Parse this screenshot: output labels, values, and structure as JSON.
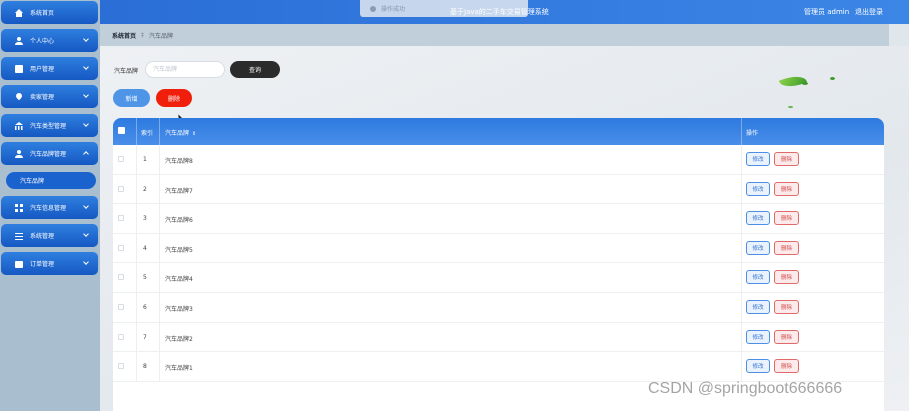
{
  "sidebar": {
    "items": [
      {
        "label": "系统首页",
        "icon": "home-icon",
        "chevron": false
      },
      {
        "label": "个人中心",
        "icon": "user-icon",
        "chevron": true
      },
      {
        "label": "用户管理",
        "icon": "document-icon",
        "chevron": true
      },
      {
        "label": "卖家管理",
        "icon": "location-pin-icon",
        "chevron": true
      },
      {
        "label": "汽车类型管理",
        "icon": "bank-icon",
        "chevron": true
      },
      {
        "label": "汽车品牌管理",
        "icon": "user-icon",
        "chevron": true,
        "expanded": true
      },
      {
        "label": "汽车信息管理",
        "icon": "grid-icon",
        "chevron": true
      },
      {
        "label": "系统管理",
        "icon": "menu-icon",
        "chevron": true
      },
      {
        "label": "订单管理",
        "icon": "bag-icon",
        "chevron": true
      }
    ],
    "sub_item": "汽车品牌"
  },
  "header": {
    "toast": "操作成功",
    "title": "基于Java的二手车交易管理系统",
    "admin": "管理员 admin",
    "logout": "退出登录"
  },
  "breadcrumb": {
    "home": "系统首页",
    "separator": "‡",
    "current": "汽车品牌"
  },
  "search": {
    "label": "汽车品牌",
    "placeholder": "汽车品牌",
    "value": "",
    "button": "查询"
  },
  "actions": {
    "add": "新增",
    "delete": "删除"
  },
  "table": {
    "headers": {
      "index": "索引",
      "brand": "汽车品牌",
      "sort_icon": "⇕",
      "ops": "操作"
    },
    "edit_label": "修改",
    "delete_label": "删除",
    "rows": [
      {
        "index": "1",
        "brand": "汽车品牌8"
      },
      {
        "index": "2",
        "brand": "汽车品牌7"
      },
      {
        "index": "3",
        "brand": "汽车品牌6"
      },
      {
        "index": "4",
        "brand": "汽车品牌5"
      },
      {
        "index": "5",
        "brand": "汽车品牌4"
      },
      {
        "index": "6",
        "brand": "汽车品牌3"
      },
      {
        "index": "7",
        "brand": "汽车品牌2"
      },
      {
        "index": "8",
        "brand": "汽车品牌1"
      }
    ]
  },
  "watermark": "CSDN @springboot666666",
  "colors": {
    "primary": "#2a6ed6",
    "danger": "#f01f0c",
    "sidebar_bg": "#a9bfd0",
    "dark_button": "#2b2b2b"
  }
}
